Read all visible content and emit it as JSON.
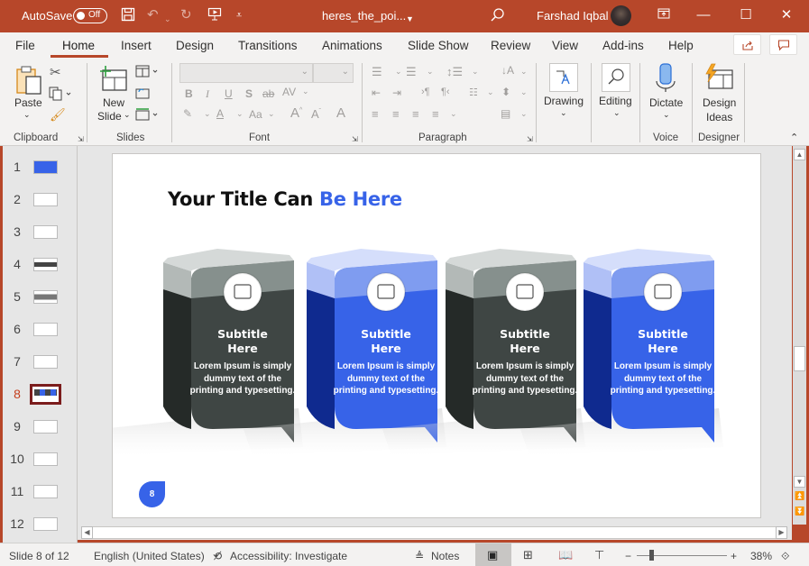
{
  "titlebar": {
    "autosave_label": "AutoSave",
    "autosave_state": "Off",
    "doc_title": "heres_the_poi...",
    "user_name": "Farshad Iqbal"
  },
  "tabs": [
    {
      "label": "File"
    },
    {
      "label": "Home"
    },
    {
      "label": "Insert"
    },
    {
      "label": "Design"
    },
    {
      "label": "Transitions"
    },
    {
      "label": "Animations"
    },
    {
      "label": "Slide Show"
    },
    {
      "label": "Review"
    },
    {
      "label": "View"
    },
    {
      "label": "Add-ins"
    },
    {
      "label": "Help"
    }
  ],
  "active_tab": "Home",
  "ribbon": {
    "clipboard": {
      "paste": "Paste",
      "group": "Clipboard"
    },
    "slides": {
      "new_slide_1": "New",
      "new_slide_2": "Slide",
      "group": "Slides"
    },
    "font": {
      "group": "Font",
      "font_name": "",
      "font_size": "",
      "bold": "B",
      "italic": "I",
      "underline": "U",
      "shadow": "S",
      "strike": "ab",
      "spacing": "AV",
      "case": "Aa"
    },
    "paragraph": {
      "group": "Paragraph"
    },
    "drawing": {
      "label": "Drawing"
    },
    "editing": {
      "label": "Editing"
    },
    "voice": {
      "label": "Dictate",
      "group": "Voice"
    },
    "designer": {
      "label_1": "Design",
      "label_2": "Ideas",
      "group": "Designer"
    }
  },
  "thumbnails": [
    {
      "num": "1"
    },
    {
      "num": "2"
    },
    {
      "num": "3"
    },
    {
      "num": "4"
    },
    {
      "num": "5"
    },
    {
      "num": "6"
    },
    {
      "num": "7"
    },
    {
      "num": "8"
    },
    {
      "num": "9"
    },
    {
      "num": "10"
    },
    {
      "num": "11"
    },
    {
      "num": "12"
    }
  ],
  "selected_slide": 8,
  "slide": {
    "title_plain": "Your Title Can ",
    "title_accent": "Be Here",
    "page_number": "8",
    "cards": [
      {
        "subtitle_1": "Subtitle",
        "subtitle_2": "Here",
        "body": "Lorem Ipsum is simply dummy text of the printing and typesetting.",
        "theme": "dark",
        "icon": "document-leaf-icon"
      },
      {
        "subtitle_1": "Subtitle",
        "subtitle_2": "Here",
        "body": "Lorem Ipsum is simply dummy text of the printing and typesetting.",
        "theme": "blue",
        "icon": "circuit-board-icon"
      },
      {
        "subtitle_1": "Subtitle",
        "subtitle_2": "Here",
        "body": "Lorem Ipsum is simply dummy text of the printing and typesetting.",
        "theme": "dark",
        "icon": "tray-leaf-icon"
      },
      {
        "subtitle_1": "Subtitle",
        "subtitle_2": "Here",
        "body": "Lorem Ipsum is simply dummy text of the printing and typesetting.",
        "theme": "blue",
        "icon": "lightbulb-leaf-icon"
      }
    ]
  },
  "colors": {
    "accent": "#b7472a",
    "slide_blue": "#3763e8",
    "slide_dark": "#3f4644"
  },
  "status": {
    "slide_info": "Slide 8 of 12",
    "language": "English (United States)",
    "accessibility": "Accessibility: Investigate",
    "notes": "Notes",
    "zoom": "38%"
  }
}
